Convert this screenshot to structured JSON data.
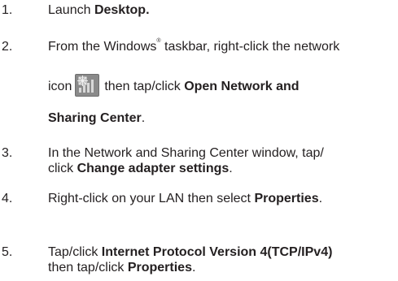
{
  "steps": [
    {
      "number": "1.",
      "pre": "Launch ",
      "bold": "Desktop."
    },
    {
      "number": "2.",
      "line1_pre": "From the Windows",
      "line1_sup": "®",
      "line1_post": " taskbar, right-click the network",
      "line2_pre": "icon",
      "line2_post": "then tap/click ",
      "line2_bold": "Open Network and",
      "line3_bold": "Sharing Center",
      "line3_post": ".",
      "icon": "network-signal-icon"
    },
    {
      "number": "3.",
      "line1": "In the Network and Sharing Center window, tap/",
      "line2_pre": "click ",
      "line2_bold": "Change adapter settings",
      "line2_post": "."
    },
    {
      "number": "4.",
      "pre": "Right-click on your LAN then select ",
      "bold": "Properties",
      "post": "."
    },
    {
      "number": "5.",
      "line1_pre": "Tap/click ",
      "line1_bold": "Internet Protocol Version 4(TCP/IPv4)",
      "line2_pre": "then tap/click ",
      "line2_bold": "Properties",
      "line2_post": "."
    }
  ],
  "colors": {
    "text": "#231f20",
    "icon_bg": "#8a8a8a"
  }
}
